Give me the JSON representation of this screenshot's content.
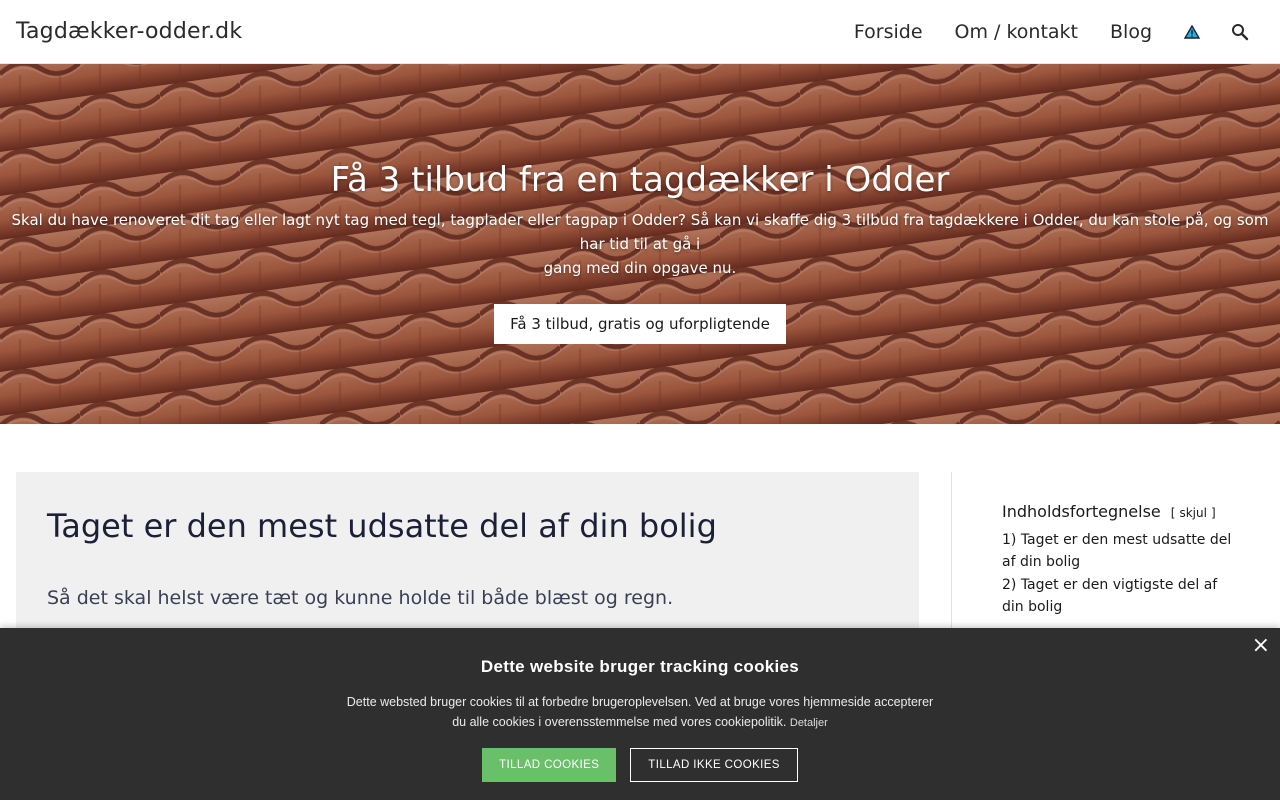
{
  "header": {
    "site_title": "Tagdækker-odder.dk",
    "nav": [
      {
        "label": "Forside"
      },
      {
        "label": "Om / kontakt"
      },
      {
        "label": "Blog"
      }
    ],
    "icons": [
      "warning-triangle-icon",
      "search-icon"
    ]
  },
  "hero": {
    "title": "Få 3 tilbud fra en tagdækker i Odder",
    "text_line1": "Skal du have renoveret dit tag eller lagt nyt tag med tegl, tagplader eller tagpap i Odder? Så kan vi skaffe dig 3 tilbud fra tagdækkere i Odder, du kan stole på, og som har tid til at gå i",
    "text_line2": "gang med din opgave nu.",
    "cta_label": "Få 3 tilbud, gratis og uforpligtende"
  },
  "article": {
    "heading": "Taget er den mest udsatte del af din bolig",
    "lead": "Så det skal helst være tæt og kunne holde til både blæst og regn."
  },
  "toc": {
    "title": "Indholdsfortegnelse",
    "toggle_open": "[",
    "toggle_label": "skjul",
    "toggle_close": "]",
    "items": [
      {
        "label": "1) Taget er den mest udsatte del af din bolig"
      },
      {
        "label": "2) Taget er den vigtigste del af din bolig"
      }
    ]
  },
  "cookie": {
    "title": "Dette website bruger tracking cookies",
    "text": "Dette websted bruger cookies til at forbedre brugeroplevelsen. Ved at bruge vores hjemmeside accepterer du alle cookies i overensstemmelse med vores cookiepolitik.",
    "details_label": "Detaljer",
    "allow_label": "TILLAD COOKIES",
    "deny_label": "TILLAD IKKE COOKIES",
    "close_label": "×"
  },
  "colors": {
    "hero_tile": "#a65a3d",
    "cookie_bg": "#2f2f2f",
    "allow_btn": "#6abf69",
    "article_bg": "#f0f0f0"
  }
}
